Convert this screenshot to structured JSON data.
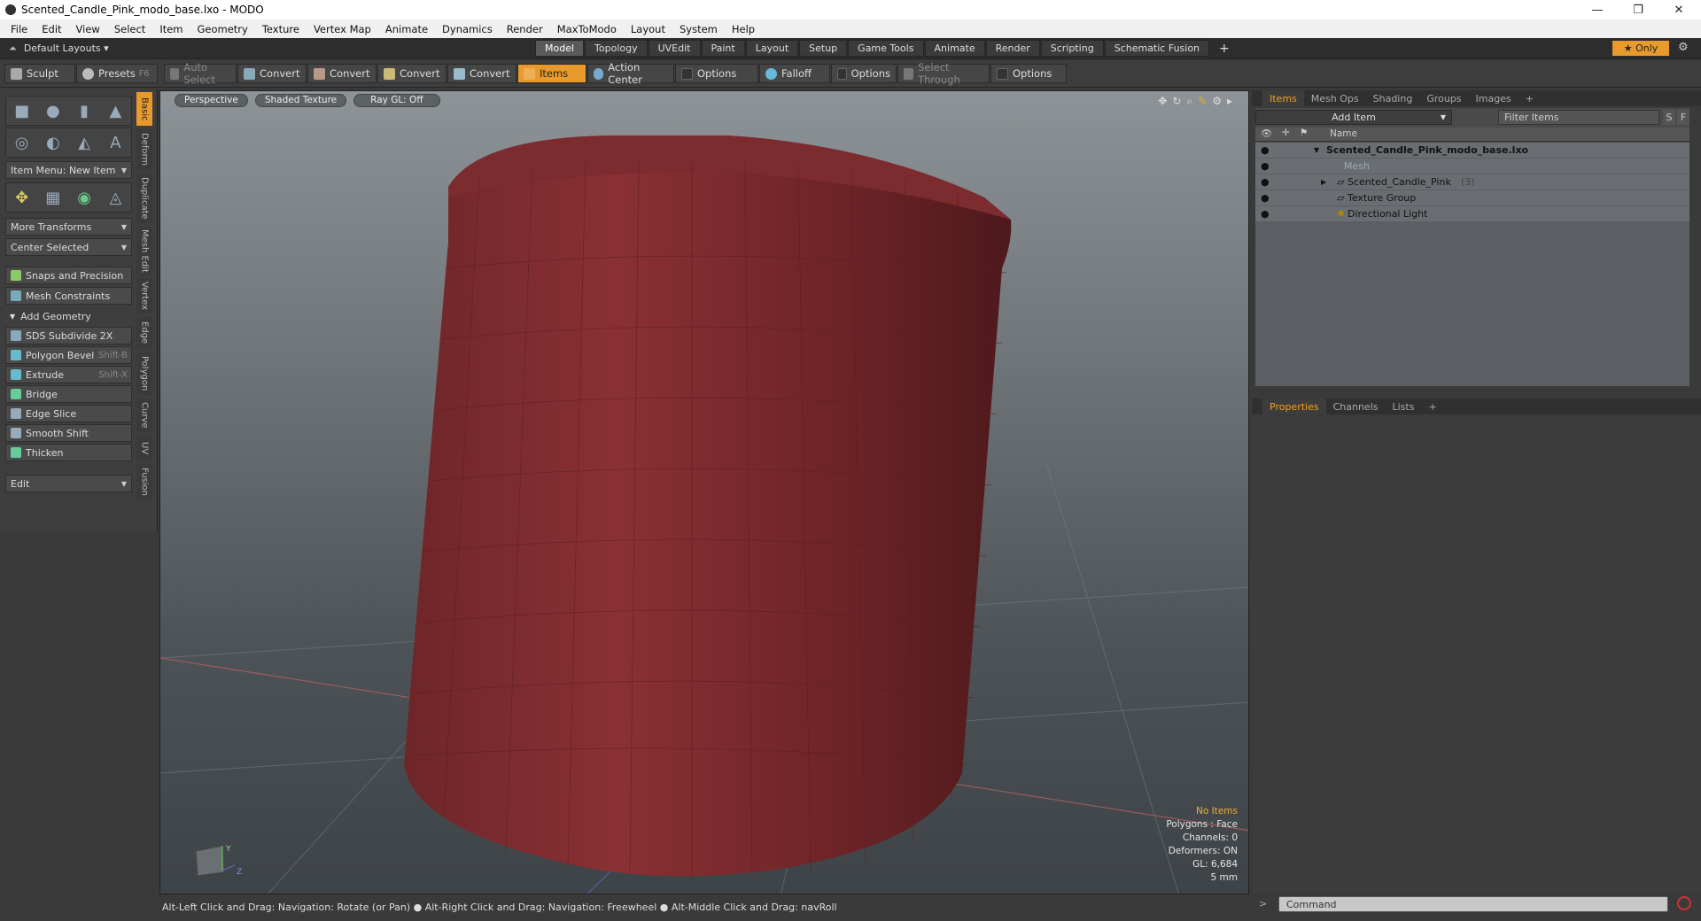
{
  "window": {
    "title": "Scented_Candle_Pink_modo_base.lxo - MODO",
    "minimize": "—",
    "maximize": "❐",
    "close": "✕"
  },
  "menu": [
    "File",
    "Edit",
    "View",
    "Select",
    "Item",
    "Geometry",
    "Texture",
    "Vertex Map",
    "Animate",
    "Dynamics",
    "Render",
    "MaxToModo",
    "Layout",
    "System",
    "Help"
  ],
  "layouts": {
    "selector": "Default Layouts",
    "tabs": [
      "Model",
      "Topology",
      "UVEdit",
      "Paint",
      "Layout",
      "Setup",
      "Game Tools",
      "Animate",
      "Render",
      "Scripting",
      "Schematic Fusion"
    ],
    "active": "Model",
    "add": "+",
    "only": "Only"
  },
  "toolbar": {
    "sculpt": "Sculpt",
    "presets": "Presets",
    "presets_key": "F6",
    "auto_select": "Auto Select",
    "convert": "Convert",
    "items": "Items",
    "action_center": "Action Center",
    "options": "Options",
    "falloff": "Falloff",
    "select_through": "Select Through"
  },
  "left": {
    "item_menu": "Item Menu: New Item",
    "more_transforms": "More Transforms",
    "center_selected": "Center Selected",
    "snaps": "Snaps and Precision",
    "constraints": "Mesh Constraints",
    "add_geometry": "Add Geometry",
    "tools": [
      {
        "label": "SDS Subdivide 2X",
        "key": ""
      },
      {
        "label": "Polygon Bevel",
        "key": "Shift-B"
      },
      {
        "label": "Extrude",
        "key": "Shift-X"
      },
      {
        "label": "Bridge",
        "key": ""
      },
      {
        "label": "Edge Slice",
        "key": ""
      },
      {
        "label": "Smooth Shift",
        "key": ""
      },
      {
        "label": "Thicken",
        "key": ""
      }
    ],
    "edit": "Edit",
    "vtabs": [
      "Basic",
      "Deform",
      "Duplicate",
      "Mesh Edit",
      "Vertex",
      "Edge",
      "Polygon",
      "Curve",
      "UV",
      "Fusion"
    ]
  },
  "viewport": {
    "view": "Perspective",
    "shading": "Shaded Texture",
    "raygl": "Ray GL: Off",
    "info": {
      "no_items": "No Items",
      "polygons": "Polygons : Face",
      "channels": "Channels: 0",
      "deformers": "Deformers: ON",
      "gl": "GL: 6,684",
      "scale": "5 mm"
    },
    "axis": {
      "y": "Y",
      "z": "Z"
    }
  },
  "status": "Alt-Left Click and Drag: Navigation: Rotate (or Pan) ● Alt-Right Click and Drag: Navigation: Freewheel ● Alt-Middle Click and Drag: navRoll",
  "items_panel": {
    "tabs": [
      "Items",
      "Mesh Ops",
      "Shading",
      "Groups",
      "Images"
    ],
    "add_item": "Add Item",
    "filter": "Filter Items",
    "s_btn": "S",
    "f_btn": "F",
    "col_name": "Name",
    "rows": [
      {
        "label": "Scented_Candle_Pink_modo_base.lxo",
        "count": ""
      },
      {
        "label": "Mesh",
        "count": ""
      },
      {
        "label": "Scented_Candle_Pink",
        "count": "(3)"
      },
      {
        "label": "Texture Group",
        "count": ""
      },
      {
        "label": "Directional Light",
        "count": ""
      }
    ]
  },
  "props_panel": {
    "tabs": [
      "Properties",
      "Channels",
      "Lists"
    ],
    "add": "+"
  },
  "command": {
    "placeholder": "Command"
  },
  "colors": {
    "accent": "#e89a2c",
    "candle": "#7a2a2e"
  }
}
